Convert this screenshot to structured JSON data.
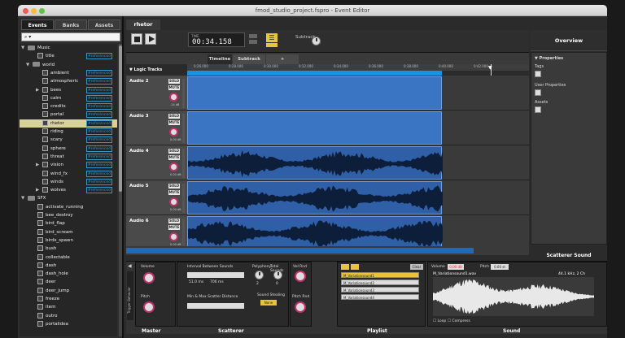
{
  "window": {
    "title": "fmod_studio_project.fspro - Event Editor"
  },
  "left": {
    "tabs": [
      "Events",
      "Banks",
      "Assets"
    ],
    "search_icon": "search-icon",
    "tree": [
      {
        "label": "Music",
        "type": "folder",
        "indent": 0,
        "arrow": "▼"
      },
      {
        "label": "title",
        "type": "event",
        "indent": 2,
        "ref": "#referenced"
      },
      {
        "label": "world",
        "type": "folder",
        "indent": 1,
        "arrow": "▼"
      },
      {
        "label": "ambient",
        "type": "event",
        "indent": 3,
        "ref": "#referenced"
      },
      {
        "label": "atmospheric",
        "type": "event",
        "indent": 3,
        "ref": "#referenced"
      },
      {
        "label": "bees",
        "type": "event",
        "indent": 3,
        "arrow": "▶",
        "ref": "#referenced"
      },
      {
        "label": "calm",
        "type": "event",
        "indent": 3,
        "ref": "#referenced"
      },
      {
        "label": "credits",
        "type": "event",
        "indent": 3,
        "ref": "#referenced"
      },
      {
        "label": "portal",
        "type": "event",
        "indent": 3,
        "ref": "#referenced"
      },
      {
        "label": "rhetor",
        "type": "event",
        "indent": 3,
        "ref": "#referenced",
        "selected": true
      },
      {
        "label": "riding",
        "type": "event",
        "indent": 3,
        "ref": "#referenced"
      },
      {
        "label": "scary",
        "type": "event",
        "indent": 3,
        "ref": "#referenced"
      },
      {
        "label": "sphere",
        "type": "event",
        "indent": 3,
        "ref": "#referenced"
      },
      {
        "label": "threat",
        "type": "event",
        "indent": 3,
        "ref": "#referenced"
      },
      {
        "label": "vision",
        "type": "event",
        "indent": 3,
        "arrow": "▶",
        "ref": "#referenced"
      },
      {
        "label": "wind_fx",
        "type": "event",
        "indent": 3,
        "ref": "#referenced"
      },
      {
        "label": "winds",
        "type": "event",
        "indent": 3,
        "ref": "#referenced"
      },
      {
        "label": "wolves",
        "type": "event",
        "indent": 3,
        "arrow": "▶",
        "ref": "#referenced"
      },
      {
        "label": "SFX",
        "type": "folder",
        "indent": 0,
        "arrow": "▼"
      },
      {
        "label": "activate_running",
        "type": "event",
        "indent": 2
      },
      {
        "label": "bee_destroy",
        "type": "event",
        "indent": 2
      },
      {
        "label": "bird_flap",
        "type": "event",
        "indent": 2
      },
      {
        "label": "bird_scream",
        "type": "event",
        "indent": 2
      },
      {
        "label": "birds_spawn",
        "type": "event",
        "indent": 2
      },
      {
        "label": "bush",
        "type": "event",
        "indent": 2
      },
      {
        "label": "collectable",
        "type": "event",
        "indent": 2
      },
      {
        "label": "dash",
        "type": "event",
        "indent": 2
      },
      {
        "label": "dash_hole",
        "type": "event",
        "indent": 2
      },
      {
        "label": "deer",
        "type": "event",
        "indent": 2
      },
      {
        "label": "deer_jump",
        "type": "event",
        "indent": 2
      },
      {
        "label": "freeze",
        "type": "event",
        "indent": 2
      },
      {
        "label": "item",
        "type": "event",
        "indent": 2
      },
      {
        "label": "outro",
        "type": "event",
        "indent": 2
      },
      {
        "label": "portalidea",
        "type": "event",
        "indent": 2
      }
    ]
  },
  "editor": {
    "event_tab": "rhetor",
    "time_label": "TIME",
    "time": "00:34.158",
    "subtrack_label": "Subtrack",
    "subtrack_value": "0.00",
    "tabs": [
      "Timeline",
      "Subtrack"
    ],
    "logic_tracks": "Logic Tracks",
    "ruler": [
      "0:26.000",
      "0:28.000",
      "0:30.000",
      "0:32.000",
      "0:34.000",
      "0:36.000",
      "0:38.000",
      "0:40.000",
      "0:42.000"
    ],
    "tracks": [
      {
        "name": "Audio 2",
        "db": "-14 dB",
        "wave": false
      },
      {
        "name": "Audio 3",
        "db": "0.00 dB",
        "wave": false
      },
      {
        "name": "Audio 4",
        "db": "0.00 dB",
        "wave": true
      },
      {
        "name": "Audio 5",
        "db": "0.00 dB",
        "wave": true
      },
      {
        "name": "Audio 6",
        "db": "0.00 dB",
        "wave": true
      }
    ],
    "solo": "SOLO",
    "mute": "MUTE"
  },
  "overview": {
    "title": "Overview",
    "properties": "Properties",
    "tags": "Tags",
    "user_properties": "User Properties",
    "assets": "Assets"
  },
  "scatterer_title": "Scatterer Sound",
  "bottom": {
    "trigger_behavior": "Trigger Behavior",
    "volume": "Volume",
    "volume_val": "0.00 dB",
    "pitch": "Pitch",
    "pitch_val": "0.00 st",
    "interval": "Interval Between Sounds",
    "interval_min": "51.0 ms",
    "interval_max": "706 ms",
    "minmax": "Min & Max Scatter Distance",
    "polyphony": "Polyphony",
    "polyphony_val": "2",
    "total_sounds": "Total Sounds",
    "total_val": "0",
    "vol_rnd": "Vol Rnd",
    "vol_rnd_val": "0.00 dB",
    "sound_stealing": "Sound Stealing",
    "none": "None",
    "pitch_rnd": "Pitch Rnd",
    "pitch_rnd_val": "0.00",
    "playlist": [
      "M_Variationsound1",
      "M_Variationsound2",
      "M_Variationsound3",
      "M_Variationsound4"
    ],
    "clear": "Clear",
    "snd_volume": "Volume",
    "snd_volume_val": "0.00 dB",
    "snd_pitch": "Pitch",
    "snd_pitch_val": "0.00 st",
    "file": "M_Variationsound1.wav",
    "format": "44.1 kHz, 2 Ch",
    "loop": "Loop",
    "compress": "Compress",
    "labels": [
      "Master",
      "Scatterer",
      "Playlist",
      "Sound"
    ]
  }
}
